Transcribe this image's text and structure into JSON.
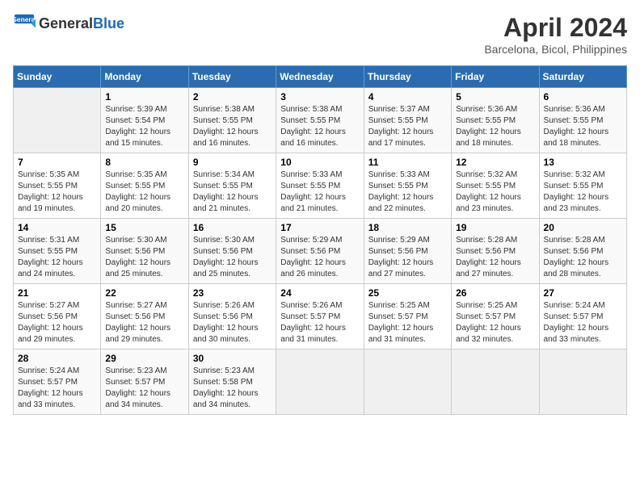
{
  "logo": {
    "line1": "General",
    "line2": "Blue"
  },
  "title": "April 2024",
  "location": "Barcelona, Bicol, Philippines",
  "days_header": [
    "Sunday",
    "Monday",
    "Tuesday",
    "Wednesday",
    "Thursday",
    "Friday",
    "Saturday"
  ],
  "weeks": [
    [
      {
        "num": "",
        "info": ""
      },
      {
        "num": "1",
        "info": "Sunrise: 5:39 AM\nSunset: 5:54 PM\nDaylight: 12 hours\nand 15 minutes."
      },
      {
        "num": "2",
        "info": "Sunrise: 5:38 AM\nSunset: 5:55 PM\nDaylight: 12 hours\nand 16 minutes."
      },
      {
        "num": "3",
        "info": "Sunrise: 5:38 AM\nSunset: 5:55 PM\nDaylight: 12 hours\nand 16 minutes."
      },
      {
        "num": "4",
        "info": "Sunrise: 5:37 AM\nSunset: 5:55 PM\nDaylight: 12 hours\nand 17 minutes."
      },
      {
        "num": "5",
        "info": "Sunrise: 5:36 AM\nSunset: 5:55 PM\nDaylight: 12 hours\nand 18 minutes."
      },
      {
        "num": "6",
        "info": "Sunrise: 5:36 AM\nSunset: 5:55 PM\nDaylight: 12 hours\nand 18 minutes."
      }
    ],
    [
      {
        "num": "7",
        "info": "Sunrise: 5:35 AM\nSunset: 5:55 PM\nDaylight: 12 hours\nand 19 minutes."
      },
      {
        "num": "8",
        "info": "Sunrise: 5:35 AM\nSunset: 5:55 PM\nDaylight: 12 hours\nand 20 minutes."
      },
      {
        "num": "9",
        "info": "Sunrise: 5:34 AM\nSunset: 5:55 PM\nDaylight: 12 hours\nand 21 minutes."
      },
      {
        "num": "10",
        "info": "Sunrise: 5:33 AM\nSunset: 5:55 PM\nDaylight: 12 hours\nand 21 minutes."
      },
      {
        "num": "11",
        "info": "Sunrise: 5:33 AM\nSunset: 5:55 PM\nDaylight: 12 hours\nand 22 minutes."
      },
      {
        "num": "12",
        "info": "Sunrise: 5:32 AM\nSunset: 5:55 PM\nDaylight: 12 hours\nand 23 minutes."
      },
      {
        "num": "13",
        "info": "Sunrise: 5:32 AM\nSunset: 5:55 PM\nDaylight: 12 hours\nand 23 minutes."
      }
    ],
    [
      {
        "num": "14",
        "info": "Sunrise: 5:31 AM\nSunset: 5:55 PM\nDaylight: 12 hours\nand 24 minutes."
      },
      {
        "num": "15",
        "info": "Sunrise: 5:30 AM\nSunset: 5:56 PM\nDaylight: 12 hours\nand 25 minutes."
      },
      {
        "num": "16",
        "info": "Sunrise: 5:30 AM\nSunset: 5:56 PM\nDaylight: 12 hours\nand 25 minutes."
      },
      {
        "num": "17",
        "info": "Sunrise: 5:29 AM\nSunset: 5:56 PM\nDaylight: 12 hours\nand 26 minutes."
      },
      {
        "num": "18",
        "info": "Sunrise: 5:29 AM\nSunset: 5:56 PM\nDaylight: 12 hours\nand 27 minutes."
      },
      {
        "num": "19",
        "info": "Sunrise: 5:28 AM\nSunset: 5:56 PM\nDaylight: 12 hours\nand 27 minutes."
      },
      {
        "num": "20",
        "info": "Sunrise: 5:28 AM\nSunset: 5:56 PM\nDaylight: 12 hours\nand 28 minutes."
      }
    ],
    [
      {
        "num": "21",
        "info": "Sunrise: 5:27 AM\nSunset: 5:56 PM\nDaylight: 12 hours\nand 29 minutes."
      },
      {
        "num": "22",
        "info": "Sunrise: 5:27 AM\nSunset: 5:56 PM\nDaylight: 12 hours\nand 29 minutes."
      },
      {
        "num": "23",
        "info": "Sunrise: 5:26 AM\nSunset: 5:56 PM\nDaylight: 12 hours\nand 30 minutes."
      },
      {
        "num": "24",
        "info": "Sunrise: 5:26 AM\nSunset: 5:57 PM\nDaylight: 12 hours\nand 31 minutes."
      },
      {
        "num": "25",
        "info": "Sunrise: 5:25 AM\nSunset: 5:57 PM\nDaylight: 12 hours\nand 31 minutes."
      },
      {
        "num": "26",
        "info": "Sunrise: 5:25 AM\nSunset: 5:57 PM\nDaylight: 12 hours\nand 32 minutes."
      },
      {
        "num": "27",
        "info": "Sunrise: 5:24 AM\nSunset: 5:57 PM\nDaylight: 12 hours\nand 33 minutes."
      }
    ],
    [
      {
        "num": "28",
        "info": "Sunrise: 5:24 AM\nSunset: 5:57 PM\nDaylight: 12 hours\nand 33 minutes."
      },
      {
        "num": "29",
        "info": "Sunrise: 5:23 AM\nSunset: 5:57 PM\nDaylight: 12 hours\nand 34 minutes."
      },
      {
        "num": "30",
        "info": "Sunrise: 5:23 AM\nSunset: 5:58 PM\nDaylight: 12 hours\nand 34 minutes."
      },
      {
        "num": "",
        "info": ""
      },
      {
        "num": "",
        "info": ""
      },
      {
        "num": "",
        "info": ""
      },
      {
        "num": "",
        "info": ""
      }
    ]
  ]
}
